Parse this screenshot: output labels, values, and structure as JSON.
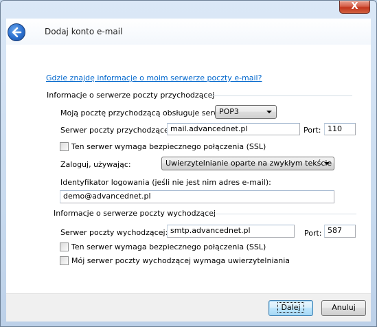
{
  "window": {
    "title": "Dodaj konto e-mail",
    "close_glyph": "X"
  },
  "help_link": "Gdzie znajdę informacje o moim serwerze poczty e-mail?",
  "incoming": {
    "section_title": "Informacje o serwerze poczty przychodzącej",
    "server_type_label": "Moją pocztę przychodzącą obsługuje serwer",
    "server_type_value": "POP3",
    "server_label": "Serwer poczty przychodzącej:",
    "server_value": "mail.advancednet.pl",
    "port_label": "Port:",
    "port_value": "110",
    "ssl_label": "Ten serwer wymaga bezpiecznego połączenia (SSL)",
    "ssl_checked": false,
    "logon_label": "Zaloguj, używając:",
    "logon_value": "Uwierzytelnianie oparte na zwykłym tekście",
    "id_label": "Identyfikator logowania (jeśli nie jest nim adres e-mail):",
    "id_value": "demo@advancednet.pl"
  },
  "outgoing": {
    "section_title": "Informacje o serwerze poczty wychodzącej",
    "server_label": "Serwer poczty wychodzącej:",
    "server_value": "smtp.advancednet.pl",
    "port_label": "Port:",
    "port_value": "587",
    "ssl_label": "Ten serwer wymaga bezpiecznego połączenia (SSL)",
    "ssl_checked": false,
    "auth_label": "Mój serwer poczty wychodzącej wymaga uwierzytelniania",
    "auth_checked": false
  },
  "footer": {
    "next_label": "Dalej",
    "cancel_label": "Anuluj"
  },
  "colors": {
    "link": "#0066cc",
    "close_button": "#c2361e",
    "back_button": "#2a6fce"
  },
  "icons": {
    "back": "back-arrow-icon",
    "close": "close-icon",
    "dropdown": "chevron-down-icon"
  }
}
